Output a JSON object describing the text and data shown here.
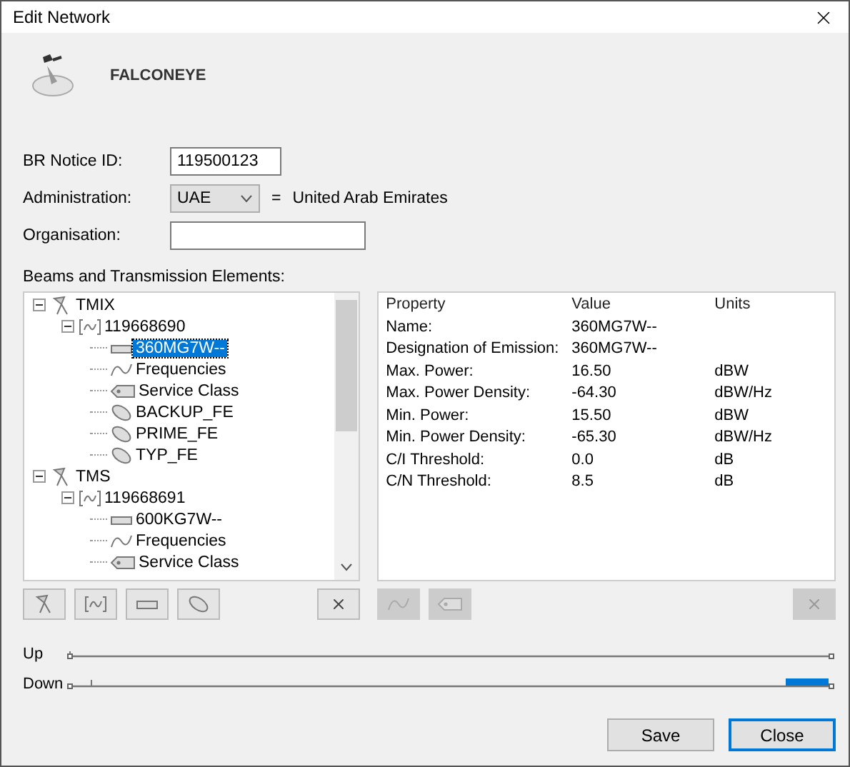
{
  "window": {
    "title": "Edit Network"
  },
  "network_name": "FALCONEYE",
  "form": {
    "notice_id": {
      "label": "BR Notice ID:",
      "value": "119500123"
    },
    "administration": {
      "label": "Administration:",
      "value": "UAE",
      "equals": "=",
      "country": "United Arab Emirates"
    },
    "organisation": {
      "label": "Organisation:"
    }
  },
  "tree_label": "Beams and Transmission Elements:",
  "tree": [
    {
      "kind": "beam",
      "label": "TMIX",
      "expanded": true,
      "selected": false,
      "children": [
        {
          "kind": "group",
          "label": "119668690",
          "expanded": true,
          "selected": false,
          "children": [
            {
              "kind": "emission",
              "label": "360MG7W--",
              "selected": true
            },
            {
              "kind": "frequencies",
              "label": "Frequencies",
              "selected": false
            },
            {
              "kind": "service",
              "label": "Service Class",
              "selected": false
            },
            {
              "kind": "station",
              "label": "BACKUP_FE",
              "selected": false
            },
            {
              "kind": "station",
              "label": "PRIME_FE",
              "selected": false
            },
            {
              "kind": "station",
              "label": "TYP_FE",
              "selected": false
            }
          ]
        }
      ]
    },
    {
      "kind": "beam",
      "label": "TMS",
      "expanded": true,
      "selected": false,
      "children": [
        {
          "kind": "group",
          "label": "119668691",
          "expanded": true,
          "selected": false,
          "children": [
            {
              "kind": "emission",
              "label": "600KG7W--",
              "selected": false
            },
            {
              "kind": "frequencies",
              "label": "Frequencies",
              "selected": false
            },
            {
              "kind": "service",
              "label": "Service Class",
              "selected": false
            }
          ]
        }
      ]
    }
  ],
  "tree_toolbar": [
    {
      "kind": "beam",
      "disabled": false
    },
    {
      "kind": "group",
      "disabled": false
    },
    {
      "kind": "emission",
      "disabled": false
    },
    {
      "kind": "station",
      "disabled": false
    },
    {
      "kind": "delete",
      "disabled": false
    }
  ],
  "properties": {
    "columns": [
      "Property",
      "Value",
      "Units"
    ],
    "rows": [
      [
        "Name:",
        "360MG7W--",
        ""
      ],
      [
        "Designation of Emission:",
        "360MG7W--",
        ""
      ],
      [
        "Max. Power:",
        "16.50",
        "dBW"
      ],
      [
        "Max. Power Density:",
        "-64.30",
        "dBW/Hz"
      ],
      [
        "Min. Power:",
        "15.50",
        "dBW"
      ],
      [
        "Min. Power Density:",
        "-65.30",
        "dBW/Hz"
      ],
      [
        "C/I Threshold:",
        "0.0",
        "dB"
      ],
      [
        "C/N Threshold:",
        "8.5",
        "dB"
      ]
    ]
  },
  "properties_toolbar": [
    {
      "kind": "frequencies",
      "disabled": true
    },
    {
      "kind": "service",
      "disabled": true
    },
    {
      "kind": "delete",
      "disabled": true
    }
  ],
  "links": [
    {
      "label": "Up"
    },
    {
      "label": "Down"
    }
  ],
  "buttons": [
    {
      "label": "Save",
      "default": false
    },
    {
      "label": "Close",
      "default": true
    }
  ]
}
